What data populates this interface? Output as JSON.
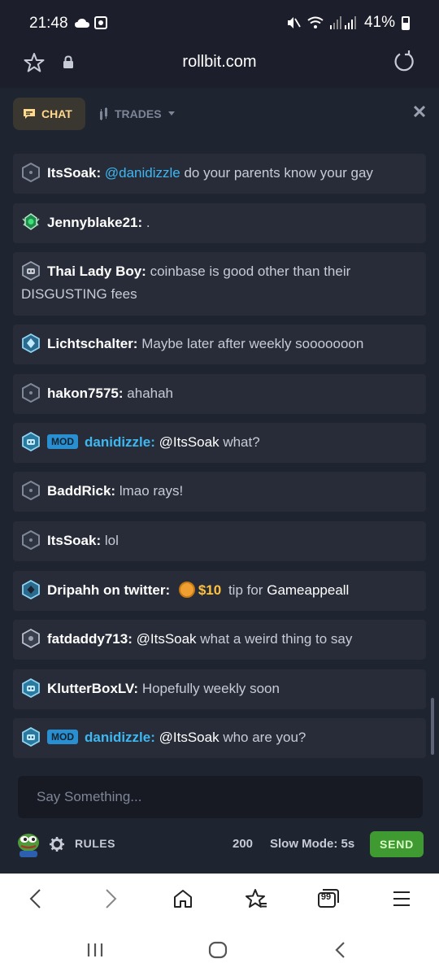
{
  "status_bar": {
    "time": "21:48",
    "battery_pct": "41%"
  },
  "browser": {
    "url": "rollbit.com"
  },
  "chat_header": {
    "chat_tab": "CHAT",
    "trades_tab": "TRADES"
  },
  "messages": [
    {
      "user": "ItsSoak:",
      "mention": "@danidizzle",
      "text": " do your parents know your gay"
    },
    {
      "user": "Jennyblake21:",
      "text": "."
    },
    {
      "user": "Thai Lady Boy:",
      "text": "coinbase is good other than their DISGUSTING fees"
    },
    {
      "user": "Lichtschalter:",
      "text": "Maybe later after weekly sooooooon"
    },
    {
      "user": "hakon7575:",
      "text": "ahahah"
    },
    {
      "mod_tag": "MOD",
      "user": "danidizzle:",
      "mention": "@ItsSoak",
      "text": " what?"
    },
    {
      "user": "BaddRick:",
      "text": "lmao rays!"
    },
    {
      "user": "ItsSoak:",
      "text": "lol"
    },
    {
      "user": "Dripahh on twitter:",
      "tip_amount": "$10",
      "tip_text": "tip for",
      "tip_target": "Gameappeall"
    },
    {
      "user": "fatdaddy713:",
      "mention": "@ItsSoak",
      "text": " what a weird thing to say"
    },
    {
      "user": "KlutterBoxLV:",
      "text": "Hopefully weekly soon"
    },
    {
      "mod_tag": "MOD",
      "user": "danidizzle:",
      "mention": "@ItsSoak",
      "text": " who are you?"
    }
  ],
  "composer": {
    "placeholder": "Say Something..."
  },
  "footer": {
    "rules_label": "RULES",
    "char_count": "200",
    "slow_mode": "Slow Mode: 5s",
    "send_label": "SEND"
  },
  "browser_nav": {
    "tab_count": "99"
  },
  "colors": {
    "background": "#1f2431",
    "message_bg": "#272c38",
    "mention": "#3db8f2",
    "send": "#3e9a31",
    "chat_tab": "#ffd98c"
  }
}
